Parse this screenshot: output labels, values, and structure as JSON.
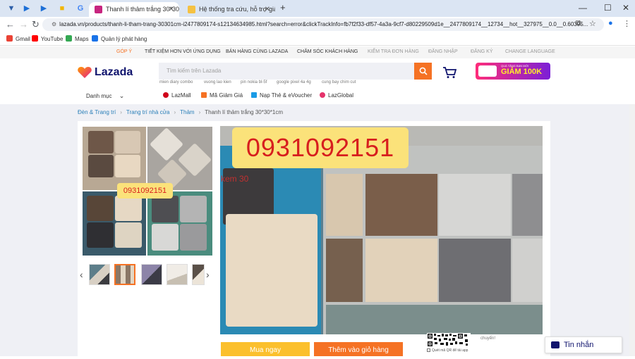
{
  "browser": {
    "tabs": [
      {
        "title": "Thanh lí thảm trắng 30*30*1cm",
        "active": true
      },
      {
        "title": "Hệ thống tra cứu, hỗ trợ giảm",
        "active": false
      }
    ],
    "url": "lazada.vn/products/thanh-li-tham-trang-30301cm-i2477809174-s12134634985.html?search=error&clickTrackInfo=fb7f2f33-df57-4a3a-9cf7-d80229509d1e__2477809174__12734__hot__327975__0.0__0.60395...",
    "bookmarks": [
      "Gmail",
      "YouTube",
      "Maps",
      "Quản lý phát hàng"
    ]
  },
  "topnav": {
    "items": [
      "GÓP Ý",
      "TIẾT KIỆM HƠN VỚI ỨNG DỤNG",
      "BÁN HÀNG CÙNG LAZADA",
      "CHĂM SÓC KHÁCH HÀNG",
      "KIỂM TRA ĐƠN HÀNG",
      "ĐĂNG NHẬP",
      "ĐĂNG KÝ",
      "CHANGE LANGUAGE"
    ]
  },
  "header": {
    "logo": "Lazada",
    "search_placeholder": "Tìm kiếm trên Lazada",
    "suggestions": [
      "mien diary combo",
      "vuong lao kien",
      "pin nokia bl-5f",
      "google pixel 4a 4g",
      "cung bay chim cut"
    ],
    "promo_small": "QUÀ TẶNG BẠN MỚI",
    "promo_big": "GIẢM 100K",
    "category": "Danh mục",
    "channels": [
      "LazMall",
      "Mã Giảm Giá",
      "Nạp Thẻ & eVoucher",
      "LazGlobal"
    ]
  },
  "breadcrumb": [
    "Đèn & Trang trí",
    "Trang trí nhà cửa",
    "Thảm",
    "Thanh lí thảm trắng 30*30*1cm"
  ],
  "product": {
    "phone": "0931092151",
    "image_note": "kem 30",
    "buy_now": "Mua ngay",
    "add_to_cart": "Thêm vào giỏ hàng",
    "qr_text": "Quét mã QR để tải app",
    "chuyen": "chuyển!"
  },
  "chat": {
    "label": "Tin nhắn"
  },
  "colors": {
    "accent": "#f57224",
    "brand": "#0f136d",
    "buy": "#fbc02d"
  }
}
